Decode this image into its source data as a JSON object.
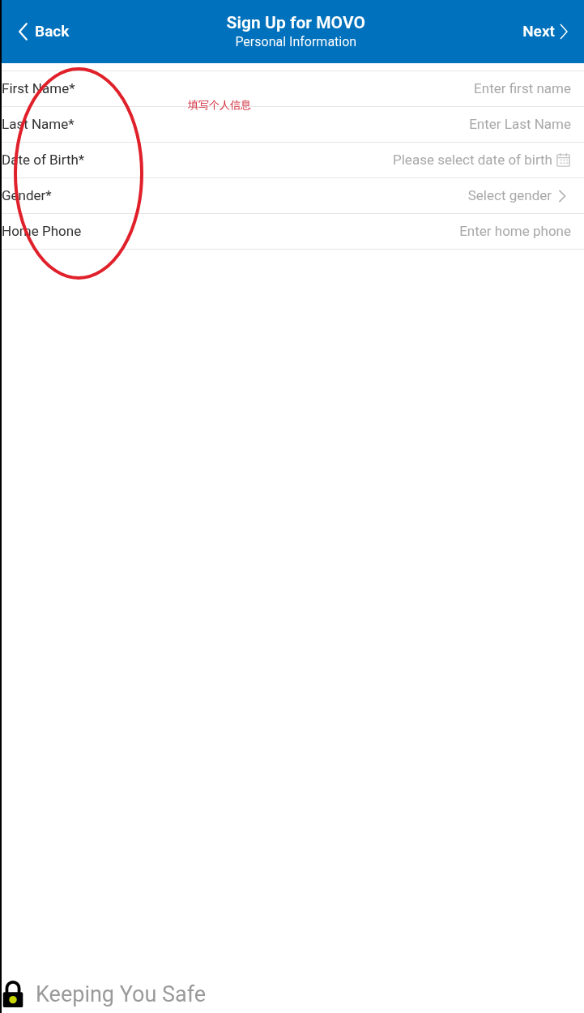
{
  "header": {
    "back": "Back",
    "title": "Sign Up for MOVO",
    "subtitle": "Personal Information",
    "next": "Next"
  },
  "fields": [
    {
      "label": "First Name*",
      "placeholder": "Enter first name",
      "kind": "text"
    },
    {
      "label": "Last Name*",
      "placeholder": "Enter Last Name",
      "kind": "text"
    },
    {
      "label": "Date of Birth*",
      "placeholder": "Please select date of birth",
      "kind": "date"
    },
    {
      "label": "Gender*",
      "placeholder": "Select gender",
      "kind": "select"
    },
    {
      "label": "Home Phone",
      "placeholder": "Enter home phone",
      "kind": "text"
    }
  ],
  "annotation": {
    "note": "填写个人信息"
  },
  "footer": {
    "text": "Keeping You Safe"
  }
}
